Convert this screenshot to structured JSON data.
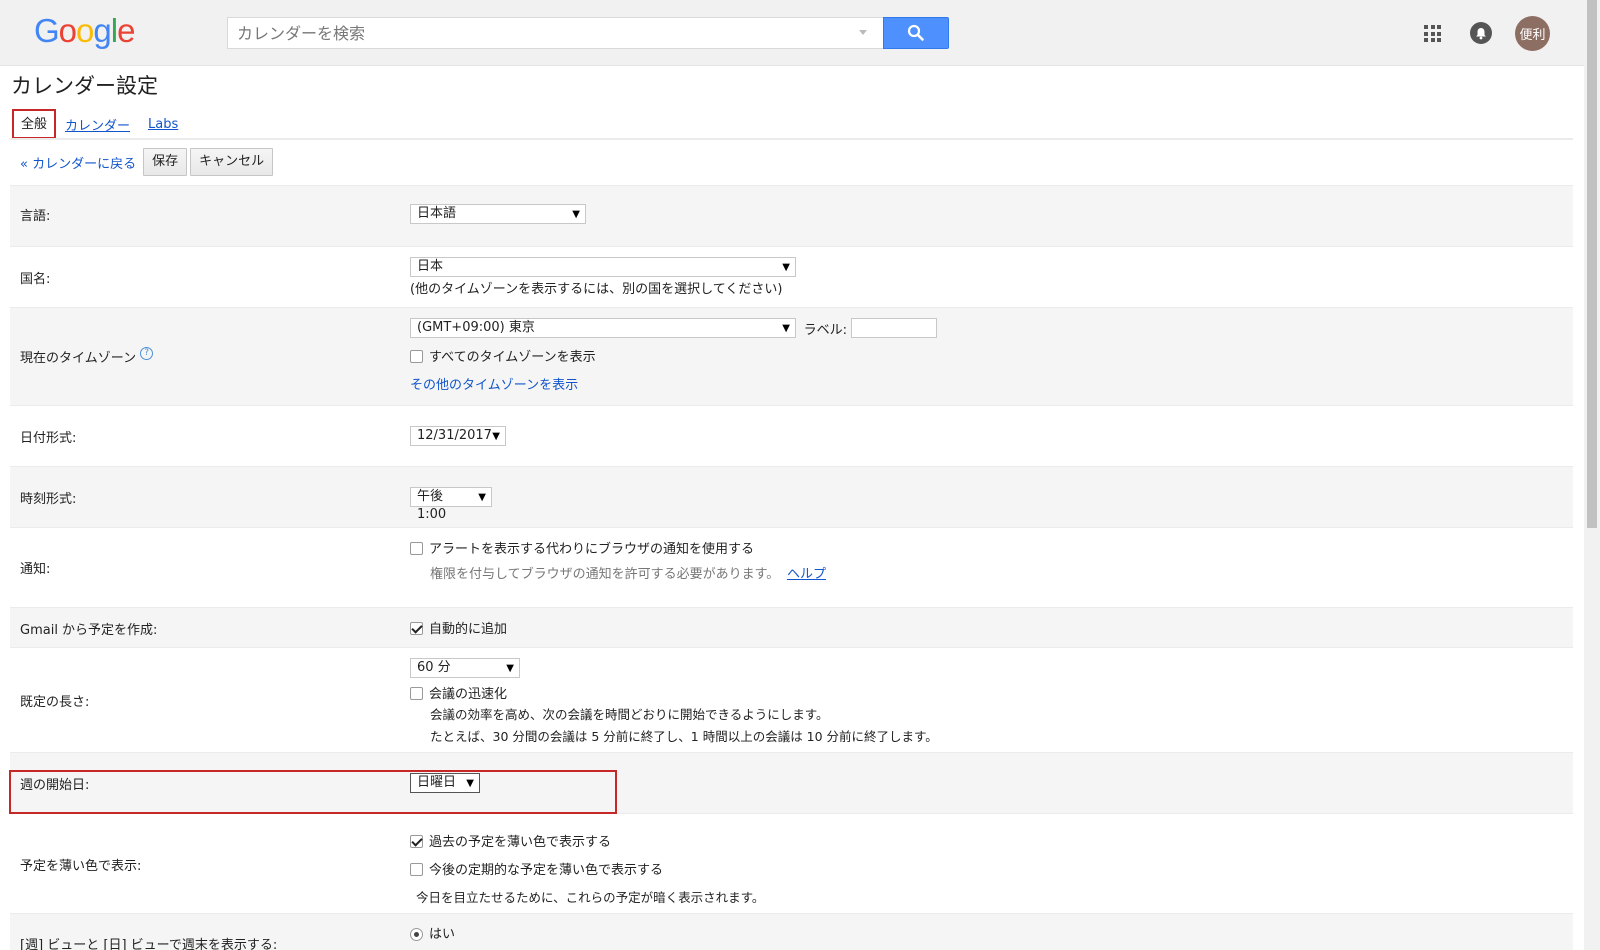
{
  "header": {
    "logo_letters": [
      "G",
      "o",
      "o",
      "g",
      "l",
      "e"
    ],
    "search_placeholder": "カレンダーを検索",
    "avatar_text": "便利"
  },
  "page": {
    "title": "カレンダー設定",
    "tabs": [
      {
        "label": "全般",
        "active": true
      },
      {
        "label": "カレンダー",
        "active": false
      },
      {
        "label": "Labs",
        "active": false
      }
    ],
    "back_link": "« カレンダーに戻る",
    "save_label": "保存",
    "cancel_label": "キャンセル"
  },
  "settings": {
    "language": {
      "label": "言語:",
      "value": "日本語"
    },
    "country": {
      "label": "国名:",
      "value": "日本",
      "hint": "(他のタイムゾーンを表示するには、別の国を選択してください)"
    },
    "timezone": {
      "label": "現在のタイムゾーン",
      "help": "?",
      "value": "(GMT+09:00) 東京",
      "label_text": "ラベル:",
      "show_all": "すべてのタイムゾーンを表示",
      "show_all_checked": false,
      "other_link": "その他のタイムゾーンを表示"
    },
    "date_format": {
      "label": "日付形式:",
      "value": "12/31/2017"
    },
    "time_format": {
      "label": "時刻形式:",
      "value": "午後1:00"
    },
    "notifications": {
      "label": "通知:",
      "option": "アラートを表示する代わりにブラウザの通知を使用する",
      "checked": false,
      "hint": "権限を付与してブラウザの通知を許可する必要があります。",
      "help_link": "ヘルプ"
    },
    "gmail_events": {
      "label": "Gmail から予定を作成:",
      "option": "自動的に追加",
      "checked": true
    },
    "default_duration": {
      "label": "既定の長さ:",
      "value": "60 分",
      "speedy": "会議の迅速化",
      "speedy_checked": false,
      "hint1": "会議の効率を高め、次の会議を時間どおりに開始できるようにします。",
      "hint2": "たとえば、30 分間の会議は 5 分前に終了し、1 時間以上の会議は 10 分前に終了します。"
    },
    "week_start": {
      "label": "週の開始日:",
      "value": "日曜日"
    },
    "dim_events": {
      "label": "予定を薄い色で表示:",
      "past": "過去の予定を薄い色で表示する",
      "past_checked": true,
      "recurring": "今後の定期的な予定を薄い色で表示する",
      "recurring_checked": false,
      "hint": "今日を目立たせるために、これらの予定が暗く表示されます。"
    },
    "weekend": {
      "label": "[週] ビューと [日] ビューで週末を表示する:",
      "option_yes": "はい",
      "yes_checked": true
    }
  },
  "colors": {
    "link": "#1155cc",
    "highlight": "#c62828",
    "search_button": "#4d90fe"
  },
  "icons": [
    "search-icon",
    "apps-grid-icon",
    "notifications-bell-icon",
    "help-icon",
    "dropdown-arrow-icon"
  ]
}
